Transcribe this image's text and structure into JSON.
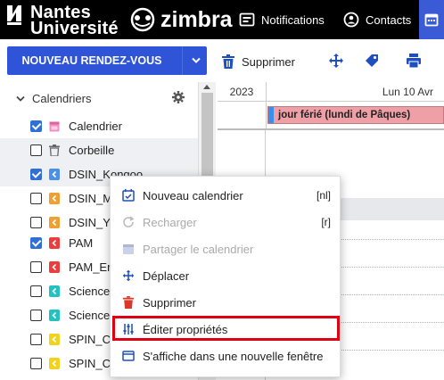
{
  "header": {
    "brand_line1": "Nantes",
    "brand_line2": "Université",
    "app_name": "zimbra",
    "nav": {
      "notifications": "Notifications",
      "contacts": "Contacts"
    },
    "colors": {
      "bar": "#000000",
      "active_tab": "#3a5ad6"
    }
  },
  "toolbar": {
    "new_label": "NOUVEAU RENDEZ-VOUS",
    "delete_label": "Supprimer",
    "icons": [
      "move-icon",
      "tag-icon",
      "print-icon"
    ]
  },
  "sidebar": {
    "header": "Calendriers",
    "items": [
      {
        "label": "Calendrier",
        "checked": true,
        "icon": "calendar-icon",
        "color": "#f28fc0"
      },
      {
        "label": "Corbeille",
        "checked": false,
        "icon": "trash-icon",
        "color": "#777777"
      },
      {
        "label": "DSIN_Kongoo",
        "checked": true,
        "icon": "shared-calendar-icon",
        "color": "#4a90e8"
      },
      {
        "label": "DSIN_M",
        "checked": false,
        "icon": "shared-calendar-icon",
        "color": "#f0a030"
      },
      {
        "label": "DSIN_Ya",
        "checked": false,
        "icon": "shared-calendar-icon",
        "color": "#f0a030"
      },
      {
        "label": "PAM",
        "checked": true,
        "icon": "shared-calendar-icon",
        "color": "#ee3b3b"
      },
      {
        "label": "PAM_Er",
        "checked": false,
        "icon": "shared-calendar-icon",
        "color": "#ee3b3b"
      },
      {
        "label": "Science",
        "checked": false,
        "icon": "shared-calendar-icon",
        "color": "#22c2c2"
      },
      {
        "label": "Science",
        "checked": false,
        "icon": "shared-calendar-icon",
        "color": "#22c2c2"
      },
      {
        "label": "SPIN_Cl",
        "checked": false,
        "icon": "shared-calendar-icon",
        "color": "#f2d21b"
      },
      {
        "label": "SPIN_Cl",
        "checked": false,
        "icon": "shared-calendar-icon",
        "color": "#f2d21b"
      }
    ]
  },
  "calendar": {
    "year": "2023",
    "day_header": "Lun 10 Avr",
    "event": {
      "title": "jour férié (lundi de Pâques)",
      "color": "#ef9fa6"
    }
  },
  "context_menu": {
    "items": [
      {
        "label": "Nouveau calendrier",
        "shortcut": "[nl]",
        "disabled": false,
        "icon": "new-calendar-icon"
      },
      {
        "label": "Recharger",
        "shortcut": "[r]",
        "disabled": true,
        "icon": "reload-icon"
      },
      {
        "label": "Partager le calendrier",
        "shortcut": "",
        "disabled": true,
        "icon": "share-calendar-icon"
      },
      {
        "label": "Déplacer",
        "shortcut": "",
        "disabled": false,
        "icon": "move-icon"
      },
      {
        "label": "Supprimer",
        "shortcut": "",
        "disabled": false,
        "icon": "delete-icon"
      },
      {
        "label": "Éditer propriétés",
        "shortcut": "",
        "disabled": false,
        "icon": "edit-properties-icon",
        "highlighted": true
      },
      {
        "label": "S'affiche dans une nouvelle fenêtre",
        "shortcut": "",
        "disabled": false,
        "icon": "new-window-icon"
      }
    ],
    "highlight_color": "#e00010"
  }
}
